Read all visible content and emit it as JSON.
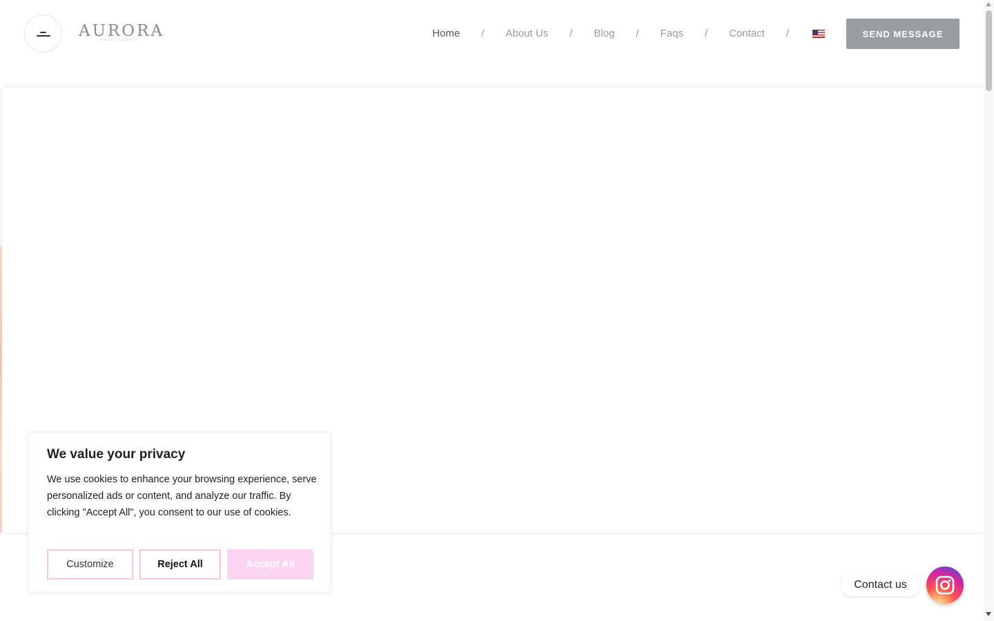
{
  "header": {
    "logo": {
      "name": "AURORA",
      "tagline": "MODEL AGENCY"
    },
    "nav": [
      {
        "label": "Home",
        "active": true
      },
      {
        "label": "About Us"
      },
      {
        "label": "Blog"
      },
      {
        "label": "Faqs"
      },
      {
        "label": "Contact"
      }
    ],
    "separator": "/",
    "language_flag": "us-flag-icon",
    "send_button": "SEND MESSAGE"
  },
  "cookie_banner": {
    "title": "We value your privacy",
    "text": "We use cookies to enhance your browsing experience, serve personalized ads or content, and analyze our traffic. By clicking \"Accept All\", you consent to our use of cookies.",
    "buttons": {
      "customize": "Customize",
      "reject": "Reject All",
      "accept": "Accept All"
    }
  },
  "contact_widget": {
    "label": "Contact us",
    "icon": "instagram-icon"
  },
  "colors": {
    "accent_pink": "#fbd4ef",
    "button_border_pink": "#f3c7e4",
    "send_button_bg": "#9b9ea1"
  }
}
